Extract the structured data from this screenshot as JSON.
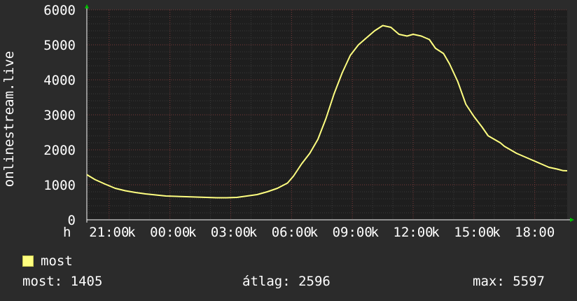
{
  "chart_data": {
    "type": "line",
    "ylabel": "onlinestream.live",
    "ylim": [
      0,
      6000
    ],
    "y_ticks": [
      "0",
      "1000",
      "2000",
      "3000",
      "4000",
      "5000",
      "6000"
    ],
    "x_unit_label": "h",
    "x_ticks": [
      "21:00",
      "00:00",
      "03:00",
      "06:00",
      "09:00",
      "12:00",
      "15:00",
      "18:00"
    ],
    "x_tick_suffix": "k",
    "xlim_hours": [
      19.9,
      43.6
    ],
    "grid": true,
    "series": [
      {
        "name": "most",
        "color": "#ffff80",
        "x": [
          19.9,
          20.3,
          20.8,
          21.3,
          21.8,
          22.3,
          22.8,
          23.3,
          23.8,
          24.3,
          24.8,
          25.3,
          25.8,
          26.3,
          26.8,
          27.3,
          27.8,
          28.3,
          28.8,
          29.3,
          29.8,
          30.1,
          30.5,
          30.9,
          31.3,
          31.7,
          32.1,
          32.5,
          32.9,
          33.3,
          33.7,
          34.1,
          34.5,
          34.9,
          35.3,
          35.7,
          36.0,
          36.4,
          36.8,
          37.1,
          37.5,
          37.8,
          38.2,
          38.6,
          39.0,
          39.4,
          39.7,
          40.0,
          40.3,
          40.5,
          40.8,
          41.1,
          41.5,
          41.9,
          42.3,
          42.7,
          43.1,
          43.4,
          43.6
        ],
        "y": [
          1290,
          1150,
          1020,
          900,
          830,
          780,
          740,
          710,
          680,
          670,
          660,
          650,
          640,
          630,
          630,
          640,
          680,
          720,
          800,
          900,
          1050,
          1250,
          1600,
          1900,
          2300,
          2900,
          3600,
          4200,
          4700,
          5000,
          5200,
          5400,
          5550,
          5500,
          5300,
          5250,
          5300,
          5250,
          5150,
          4900,
          4750,
          4450,
          3950,
          3300,
          2950,
          2650,
          2400,
          2300,
          2200,
          2100,
          2000,
          1900,
          1800,
          1700,
          1600,
          1500,
          1450,
          1405,
          1400
        ]
      }
    ]
  },
  "legend": {
    "label": "most"
  },
  "stats": {
    "most": "most: 1405",
    "avg": "átlag: 2596",
    "max": "max: 5597"
  },
  "colors": {
    "background": "#2b2b2b",
    "plot_bg": "#1e1e1e",
    "grid_minor": "#3a3a3a",
    "grid_major": "#7a3a3a",
    "line": "#ffff80",
    "axis": "#ffffff",
    "arrow": "#00c000"
  }
}
